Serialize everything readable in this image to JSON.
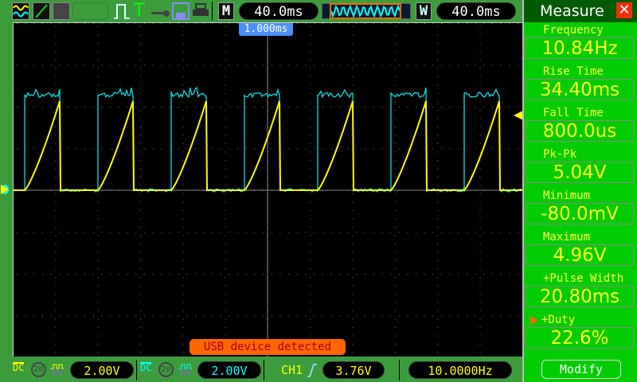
{
  "toolbar": {
    "icons": [
      "dual-wave-icon",
      "line-icon",
      "persistence-icon",
      "blank-button",
      "pulse-icon",
      "trigger-t-icon",
      "key-icon",
      "save-disk-icon",
      "printer-icon"
    ],
    "main_label": "M",
    "main_timebase": "40.0ms",
    "window_label": "W",
    "window_timebase": "40.0ms",
    "trigger_position": "1.000ms"
  },
  "screen": {
    "status_message": "USB device detected",
    "ch1_color": "#ffff00",
    "ch2_color": "#00e0e0",
    "message_color": "#ff6600"
  },
  "bottom": {
    "ch1": {
      "coupling": "DC",
      "bw": "20",
      "volts": "2.00V"
    },
    "ch2": {
      "coupling": "DC",
      "bw": "20",
      "volts": "2.00V"
    },
    "trigger_source": "CH1",
    "trigger_level": "3.76V",
    "frequency": "10.0000Hz"
  },
  "measure": {
    "title": "Measure",
    "items": [
      {
        "label": "Frequency",
        "value": "10.84Hz"
      },
      {
        "label": "Rise Time",
        "value": "34.40ms"
      },
      {
        "label": "Fall Time",
        "value": "800.0us"
      },
      {
        "label": "Pk-Pk",
        "value": "5.04V"
      },
      {
        "label": "Minimum",
        "value": "-80.0mV"
      },
      {
        "label": "Maximum",
        "value": "4.96V"
      },
      {
        "label": "+Pulse Width",
        "value": "20.80ms"
      },
      {
        "label": "+Duty",
        "value": "22.6%"
      }
    ],
    "modify_label": "Modify"
  }
}
